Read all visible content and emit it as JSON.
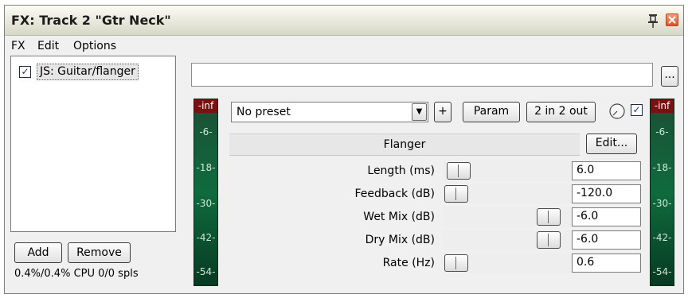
{
  "window": {
    "title": "FX: Track 2 \"Gtr Neck\""
  },
  "menu": {
    "items": [
      "FX",
      "Edit",
      "Options"
    ]
  },
  "fx_chain": {
    "items": [
      {
        "label": "JS: Guitar/flanger",
        "enabled": true
      }
    ],
    "add_label": "Add",
    "remove_label": "Remove",
    "cpu_text": "0.4%/0.4% CPU 0/0 spls"
  },
  "toolbar": {
    "browse_label": "...",
    "preset": "No preset",
    "add_preset_label": "+",
    "param_label": "Param",
    "io_label": "2 in 2 out",
    "bypass_checked": true
  },
  "meters": {
    "peak_label": "-inf",
    "ticks": [
      "-6-",
      "-18-",
      "-30-",
      "-42-",
      "-54-"
    ]
  },
  "plugin": {
    "name": "Flanger",
    "edit_label": "Edit...",
    "params": [
      {
        "label": "Length (ms)",
        "value": "6.0",
        "level": 0.02
      },
      {
        "label": "Feedback (dB)",
        "value": "-120.0",
        "level": 0.0
      },
      {
        "label": "Wet Mix (dB)",
        "value": "-6.0",
        "level": 0.84
      },
      {
        "label": "Dry Mix (dB)",
        "value": "-6.0",
        "level": 0.84
      },
      {
        "label": "Rate (Hz)",
        "value": "0.6",
        "level": 0.0
      }
    ]
  },
  "colors": {
    "meter_green": "#0f6b3e",
    "peak_red": "#7a1111"
  }
}
